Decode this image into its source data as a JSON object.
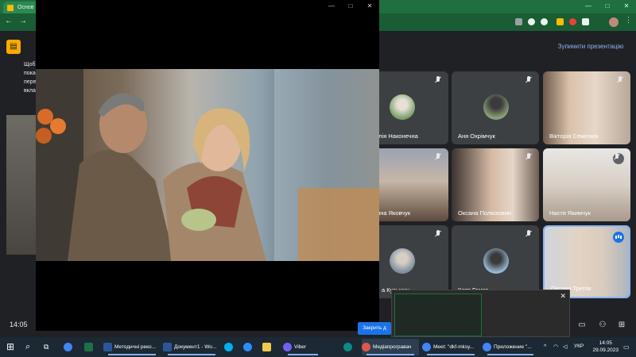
{
  "browser": {
    "tab_title": "Основ",
    "window_controls": [
      "—",
      "□",
      "✕"
    ]
  },
  "meet": {
    "stop_presenting_label": "Зупинити презентацію",
    "presentation_text": [
      "Щоб",
      "пока",
      "пере",
      "вкла"
    ],
    "participants": [
      {
        "name": "алія Наконечна",
        "muted": true,
        "type": "avatar"
      },
      {
        "name": "Аня Охрімчук",
        "muted": true,
        "type": "avatar"
      },
      {
        "name": "Вікторія Семенюк",
        "muted": true,
        "type": "video"
      },
      {
        "name": "ина Яковчук",
        "muted": true,
        "type": "video"
      },
      {
        "name": "Оксана Полюховин",
        "muted": true,
        "type": "video"
      },
      {
        "name": "Настя Якимчук",
        "muted": true,
        "type": "video"
      },
      {
        "name": "а Кузьмич",
        "muted": true,
        "type": "avatar"
      },
      {
        "name": "Катя Гамза",
        "muted": true,
        "type": "avatar"
      },
      {
        "name": "Оксана Третяк",
        "muted": false,
        "speaking": true,
        "type": "video"
      }
    ],
    "time": "14:05",
    "close_label": "Закрить д"
  },
  "taskbar": {
    "items": [
      {
        "label": "",
        "icon": "chrome",
        "color": "#4285f4"
      },
      {
        "label": "",
        "icon": "excel",
        "color": "#1e7145"
      },
      {
        "label": "Методичні реко...",
        "icon": "word",
        "color": "#2b579a"
      },
      {
        "label": "Документ1 - Wo...",
        "icon": "word",
        "color": "#2b579a"
      },
      {
        "label": "",
        "icon": "skype",
        "color": "#00aff0"
      },
      {
        "label": "",
        "icon": "zoom",
        "color": "#2d8cff"
      },
      {
        "label": "",
        "icon": "folder",
        "color": "#f2c94c"
      },
      {
        "label": "Viber",
        "icon": "viber",
        "color": "#7360f2"
      },
      {
        "label": "",
        "icon": "edge",
        "color": "#0c8a8a"
      },
      {
        "label": "Медіапрогравач",
        "icon": "media-player",
        "color": "#e0564c"
      },
      {
        "label": "Meet: \"dkf-mksy...",
        "icon": "chrome",
        "color": "#4285f4"
      },
      {
        "label": "Приложение \"...",
        "icon": "chrome",
        "color": "#4285f4"
      }
    ],
    "language": "УКР",
    "clock_time": "14:05",
    "clock_date": "29.09.2023"
  }
}
